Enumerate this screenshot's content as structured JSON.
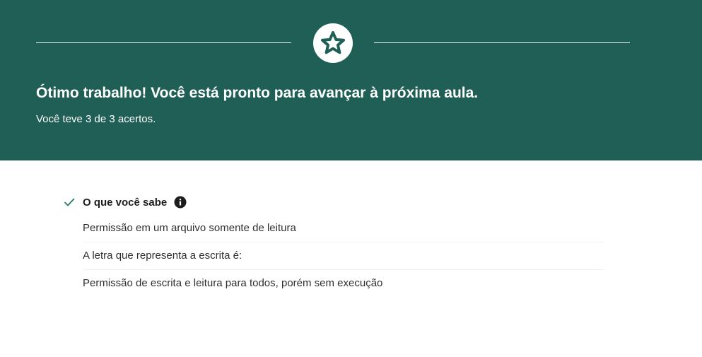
{
  "hero": {
    "title": "Ótimo trabalho! Você está pronto para avançar à próxima aula.",
    "subtitle": "Você teve 3 de 3 acertos.",
    "badge_icon": "star-icon",
    "background_color": "#1f5f55"
  },
  "summary": {
    "title": "O que você sabe",
    "status_icon": "check-icon",
    "info_icon": "info-icon",
    "accent_color": "#1f7a5a",
    "items": [
      {
        "label": "Permissão em um arquivo somente de leitura"
      },
      {
        "label": "A letra que representa a escrita é:"
      },
      {
        "label": "Permissão de escrita e leitura para todos, porém sem execução"
      }
    ]
  }
}
